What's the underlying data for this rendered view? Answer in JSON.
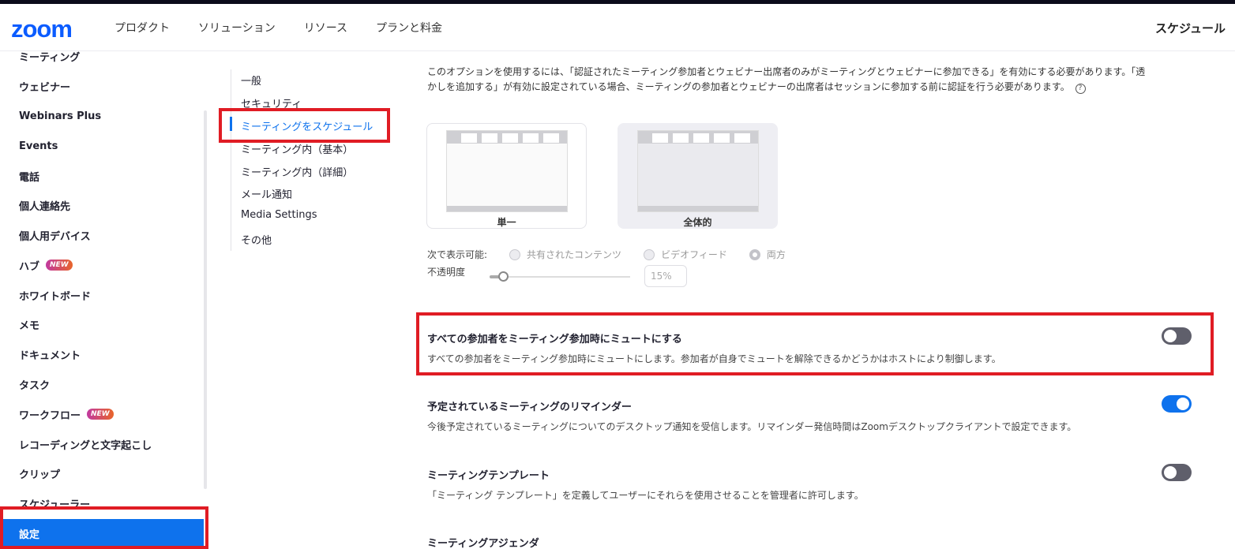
{
  "header": {
    "logo": "zoom",
    "nav": [
      "プロダクト",
      "ソリューション",
      "リソース",
      "プランと料金"
    ],
    "right_link": "スケジュール"
  },
  "sidebar": {
    "items": [
      {
        "label": "ミーティング"
      },
      {
        "label": "ウェビナー"
      },
      {
        "label": "Webinars Plus"
      },
      {
        "label": "Events"
      },
      {
        "label": "電話"
      },
      {
        "label": "個人連絡先"
      },
      {
        "label": "個人用デバイス"
      },
      {
        "label": "ハブ",
        "badge": "NEW"
      },
      {
        "label": "ホワイトボード"
      },
      {
        "label": "メモ"
      },
      {
        "label": "ドキュメント"
      },
      {
        "label": "タスク"
      },
      {
        "label": "ワークフロー",
        "badge": "NEW"
      },
      {
        "label": "レコーディングと文字起こし"
      },
      {
        "label": "クリップ"
      },
      {
        "label": "スケジューラー"
      },
      {
        "label": "設定"
      }
    ]
  },
  "submenu": {
    "items": [
      "一般",
      "セキュリティ",
      "ミーティングをスケジュール",
      "ミーティング内（基本）",
      "ミーティング内（詳細）",
      "メール通知",
      "Media Settings",
      "その他"
    ]
  },
  "watermark": {
    "description": "このオプションを使用するには、「認証されたミーティング参加者とウェビナー出席者のみがミーティングとウェビナーに参加できる」を有効にする必要があります。「透かしを追加する」が有効に設定されている場合、ミーティングの参加者とウェビナーの出席者はセッションに参加する前に認証を行う必要があります。",
    "help": "?",
    "cards": [
      "単一",
      "全体的"
    ],
    "visible_label": "次で表示可能:",
    "visible_options": [
      "共有されたコンテンツ",
      "ビデオフィード",
      "両方"
    ],
    "opacity_label": "不透明度",
    "opacity_value": "15%",
    "opacity_fraction": 0.15
  },
  "settings": {
    "mute": {
      "title": "すべての参加者をミーティング参加時にミュートにする",
      "text": "すべての参加者をミーティング参加時にミュートにします。参加者が自身でミュートを解除できるかどうかはホストにより制御します。"
    },
    "reminder": {
      "title": "予定されているミーティングのリマインダー",
      "text": "今後予定されているミーティングについてのデスクトップ通知を受信します。リマインダー発信時間はZoomデスクトップクライアントで設定できます。"
    },
    "template": {
      "title": "ミーティングテンプレート",
      "text": "「ミーティング テンプレート」を定義してユーザーにそれらを使用させることを管理者に許可します。"
    },
    "agenda": {
      "title": "ミーティングアジェンダ"
    }
  },
  "colors": {
    "accent": "#0e72ed",
    "highlight": "#e01c24",
    "toggle_off": "#5f5f6b"
  }
}
